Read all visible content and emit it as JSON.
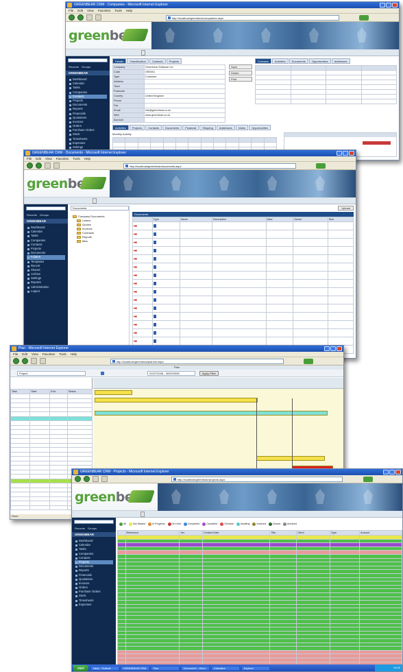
{
  "browser": {
    "menu": [
      "File",
      "Edit",
      "View",
      "Favorites",
      "Tools",
      "Help"
    ],
    "back_label": "Back",
    "search_label": "Search",
    "go_label": "Go"
  },
  "app": {
    "logo_part1": "green",
    "logo_part2": "bear",
    "search_placeholder": "",
    "radio_1": "Records",
    "radio_2": "Groups"
  },
  "screen1": {
    "window_title": "GREENBEAR CRM - Companies - Microsoft Internet Explorer",
    "address": "http://localhost/greenbear/companies.aspx",
    "tabs": [
      "Details",
      "Classification",
      "Contacts",
      "Projects"
    ],
    "right_tabs": [
      "Contacts",
      "Activities",
      "Documents",
      "Opportunities",
      "Addresses"
    ],
    "bottom_tabs": [
      "Activities",
      "Projects",
      "Contacts",
      "Documents",
      "Financial",
      "Shipping",
      "Addresses",
      "Notes",
      "Opportunities"
    ],
    "fields": [
      {
        "label": "Company",
        "value": "Greenbear Software Ltd"
      },
      {
        "label": "Code",
        "value": "GBS001"
      },
      {
        "label": "Type",
        "value": "Customer"
      },
      {
        "label": "Address",
        "value": ""
      },
      {
        "label": "Town",
        "value": ""
      },
      {
        "label": "Postcode",
        "value": ""
      },
      {
        "label": "Country",
        "value": "United Kingdom"
      },
      {
        "label": "Phone",
        "value": ""
      },
      {
        "label": "Fax",
        "value": ""
      },
      {
        "label": "Email",
        "value": "info@greenbear.co.uk"
      },
      {
        "label": "Web",
        "value": "www.greenbear.co.uk"
      },
      {
        "label": "Account",
        "value": ""
      }
    ],
    "side_buttons": [
      "Save",
      "Delete",
      "Print"
    ],
    "sidebar_items": [
      "Dashboard",
      "Calendar",
      "Tasks",
      "Companies",
      "Contacts",
      "Projects",
      "Documents",
      "Reports",
      "Financials",
      "Quotations",
      "Invoices",
      "Orders",
      "Purchase Orders",
      "Stock",
      "Timesheets",
      "Expenses",
      "Settings",
      "Users",
      "Logout"
    ],
    "sidebar_selected": "Contacts",
    "chart_label": "Monthly Activity"
  },
  "screen2": {
    "window_title": "GREENBEAR CRM - Documents - Microsoft Internet Explorer",
    "address": "http://localhost/greenbear/documents.aspx",
    "folder_label": "Documents",
    "folders": [
      "Company Documents",
      "Letters",
      "Quotes",
      "Invoices",
      "Contracts",
      "Reports",
      "Misc"
    ],
    "list_title": "Documents",
    "columns": [
      "",
      "Type",
      "Name",
      "Description",
      "Date",
      "Owner",
      "Size"
    ],
    "rows_count": 16,
    "upload_label": "Upload",
    "sidebar_items": [
      "Dashboard",
      "Calendar",
      "Tasks",
      "Companies",
      "Contacts",
      "Projects",
      "Documents",
      "Folders",
      "Templates",
      "Recent",
      "Shared",
      "Archive",
      "Settings",
      "Reports",
      "Administration",
      "Logout"
    ],
    "sidebar_selected": "Folders"
  },
  "screen3": {
    "window_title": "Plan - Microsoft Internet Explorer",
    "address": "http://localhost/greenbear/planner.aspx",
    "heading": "Plan",
    "filter_label": "Project",
    "date_range": "01/07/2008 - 30/09/2008",
    "apply_label": "Apply Filter",
    "grid_header": [
      "Task",
      "Start",
      "End",
      "Status"
    ],
    "task_count": 26,
    "status_text": "Done"
  },
  "screen4": {
    "window_title": "GREENBEAR CRM - Projects - Microsoft Internet Explorer",
    "address": "http://localhost/greenbear/projects.aspx",
    "legend": [
      "All",
      "Not Started",
      "In Progress",
      "On Hold",
      "Completed",
      "Cancelled",
      "Overdue",
      "Awaiting",
      "Invoiced",
      "Closed",
      "Archived"
    ],
    "columns": [
      "",
      "Reference",
      "Ver",
      "Created Date",
      "Title",
      "Client",
      "Type",
      "Amount"
    ],
    "rows_count": 34,
    "taskbar": {
      "start": "start",
      "items": [
        "Inbox - Outlook",
        "GREENBEAR CRM",
        "Plan",
        "Document1 - Word",
        "Calculator",
        "Explorer"
      ],
      "clock": "10:42"
    }
  },
  "colors": {
    "green_row": "#4fc04a",
    "pink_row": "#e89a9a",
    "yellow_row": "#e8e84a",
    "purple_row": "#9a4acc",
    "navy": "#0f2a4e"
  }
}
